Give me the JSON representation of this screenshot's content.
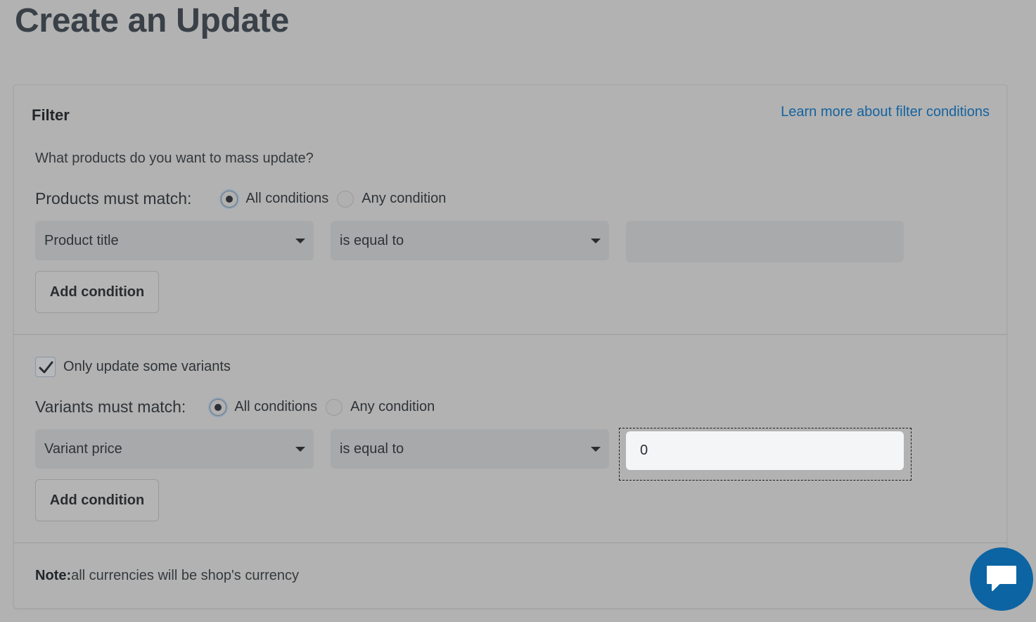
{
  "page": {
    "title": "Create an Update"
  },
  "filter": {
    "title": "Filter",
    "learn_link": "Learn more about filter conditions",
    "question": "What products do you want to mass update?",
    "products": {
      "match_label": "Products must match:",
      "options": [
        "All conditions",
        "Any condition"
      ],
      "selected": "All conditions",
      "condition": {
        "field": "Product title",
        "operator": "is equal to",
        "value": ""
      },
      "add_label": "Add condition"
    },
    "variants_toggle": {
      "label": "Only update some variants",
      "checked": true
    },
    "variants": {
      "match_label": "Variants must match:",
      "options": [
        "All conditions",
        "Any condition"
      ],
      "selected": "All conditions",
      "condition": {
        "field": "Variant price",
        "operator": "is equal to",
        "value": "0"
      },
      "add_label": "Add condition"
    },
    "note": {
      "bold": "Note:",
      "text": "all currencies will be shop's currency"
    }
  },
  "chat": {
    "icon": "chat-bubble-icon",
    "color": "#0c64a3"
  },
  "colors": {
    "link": "#15639f",
    "background": "#b2b2b2",
    "input_focus_bg": "#f4f5f7"
  }
}
